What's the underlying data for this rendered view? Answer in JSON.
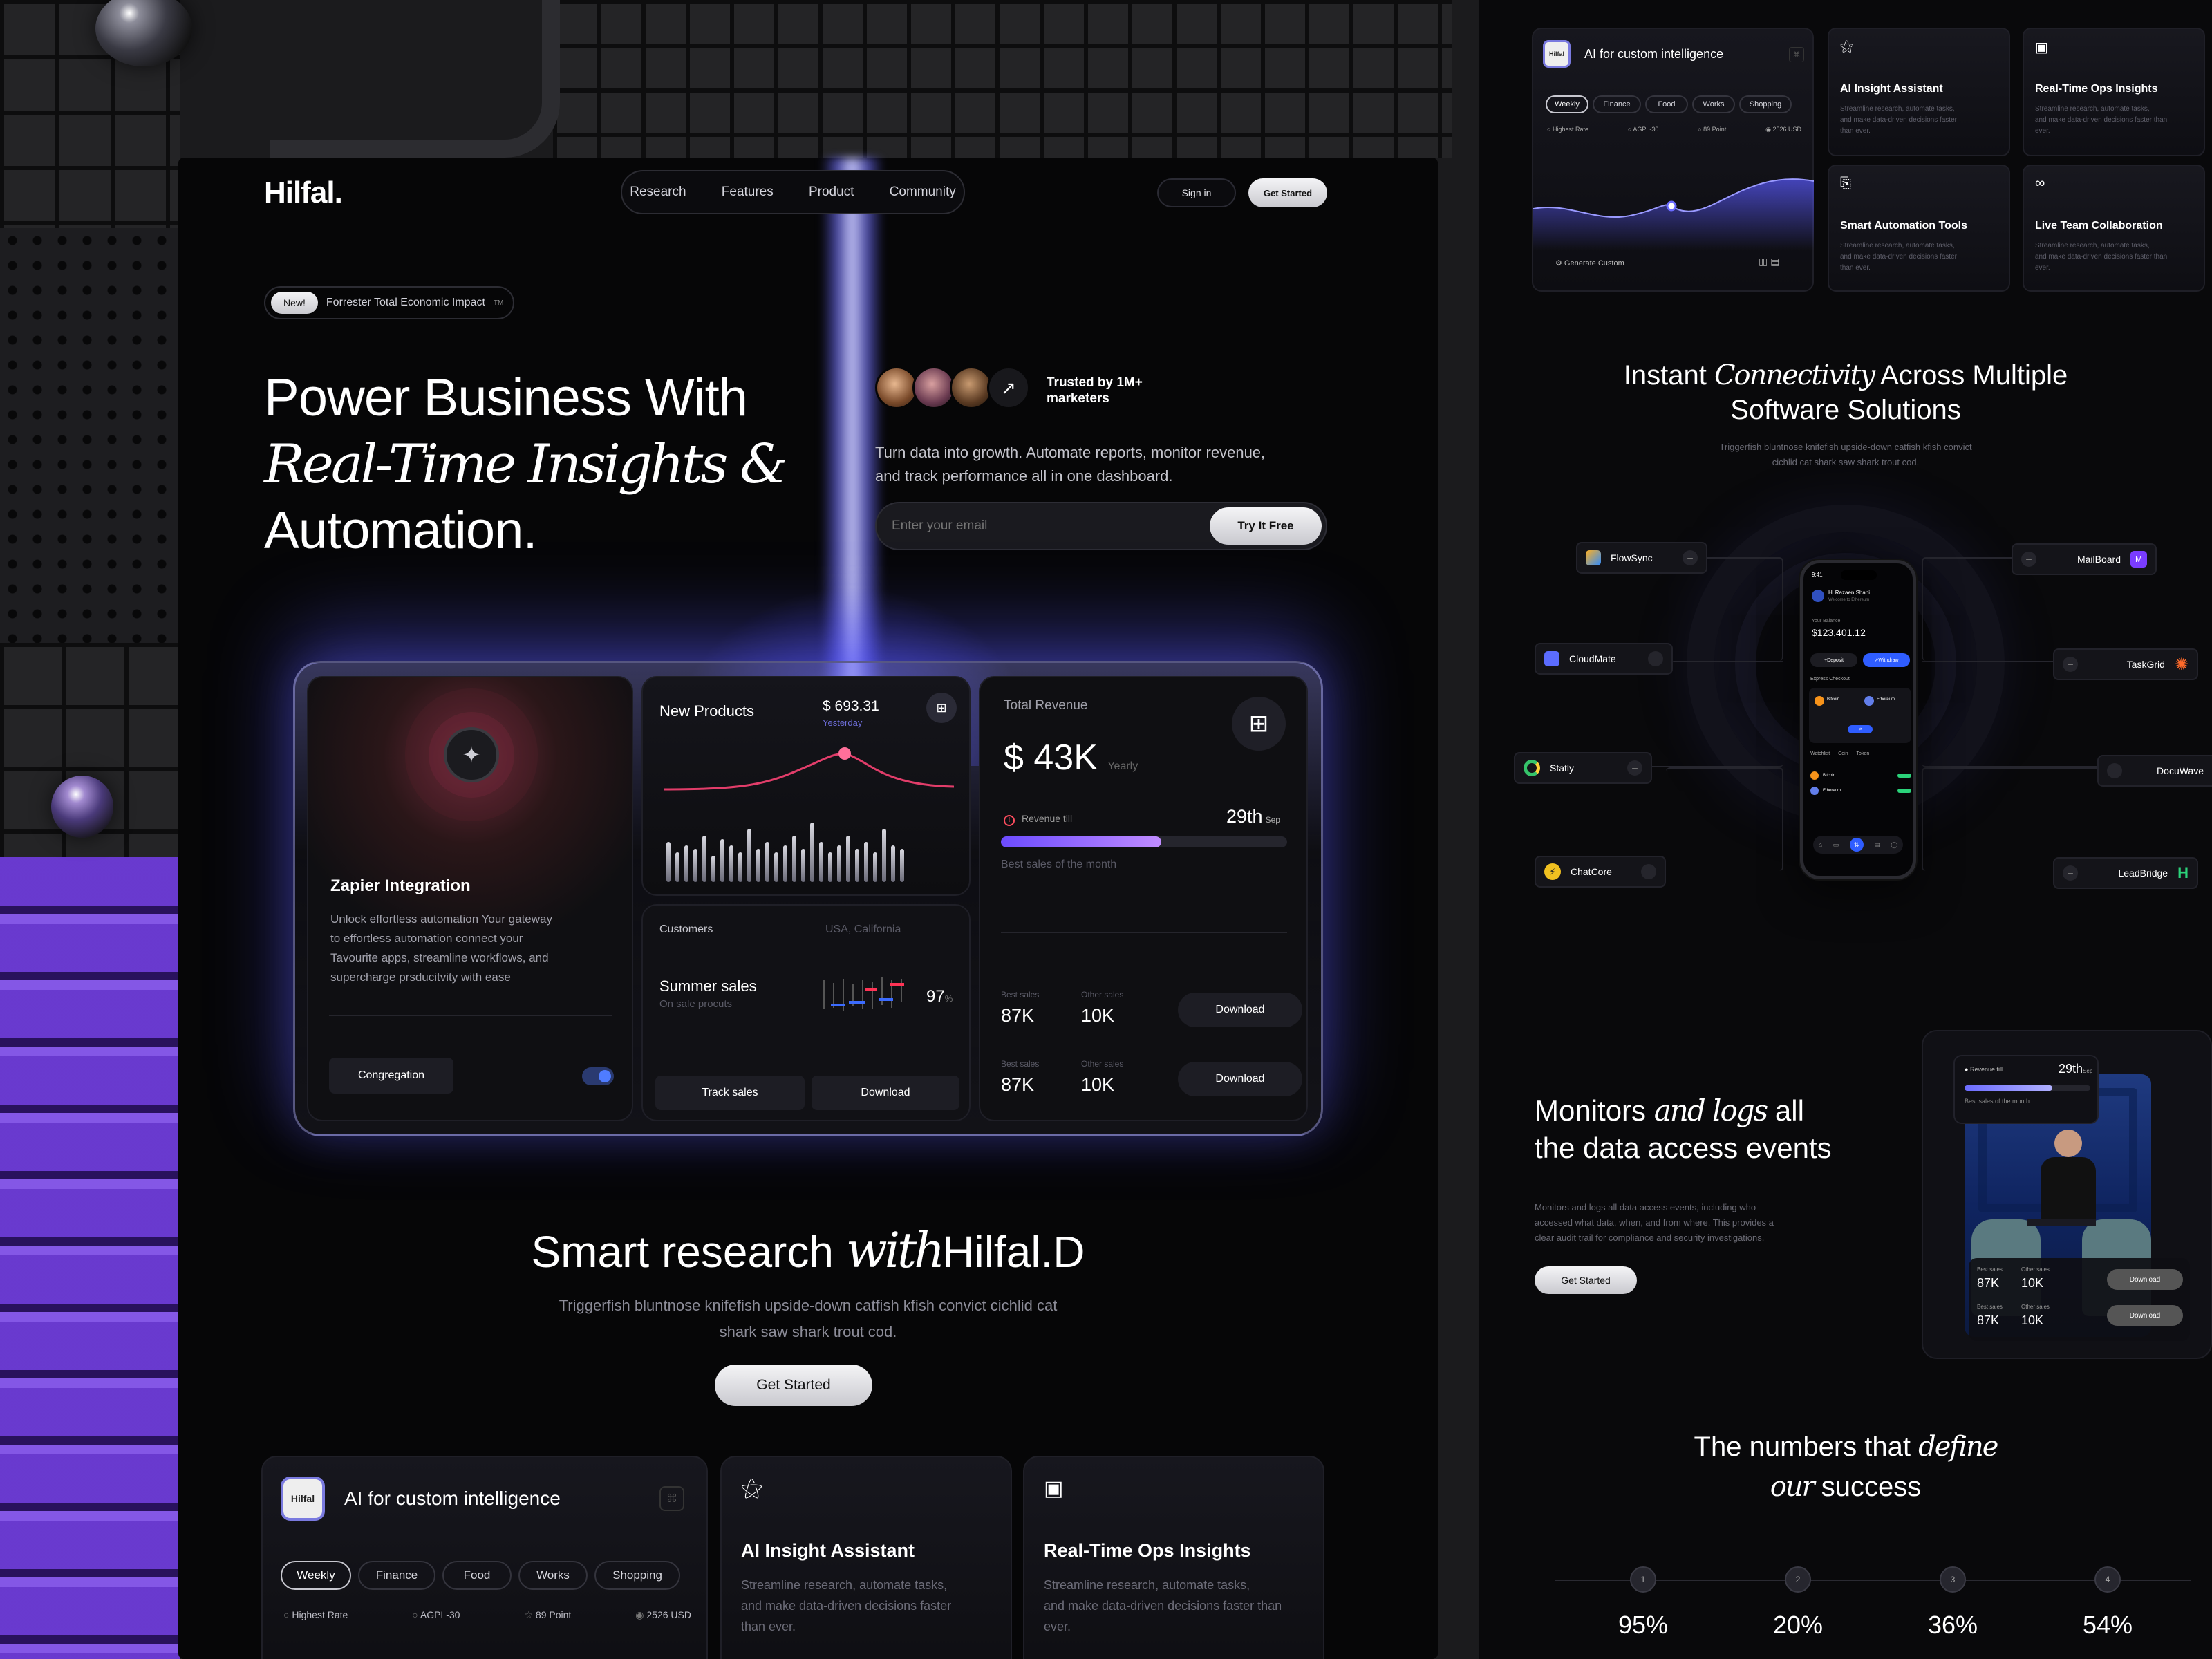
{
  "brand": "Hilfal.",
  "nav": {
    "items": [
      "Research",
      "Features",
      "Product",
      "Community"
    ],
    "signin": "Sign in",
    "get_started": "Get Started"
  },
  "badge": {
    "new": "New!",
    "text": "Forrester Total Economic Impact",
    "tm": "TM"
  },
  "hero": {
    "line1": "Power Business With",
    "line2": "Real-Time Insights &",
    "line3": "Automation.",
    "trusted": "Trusted by 1M+",
    "trusted2": "marketers",
    "desc1": "Turn data into growth. Automate reports, monitor revenue,",
    "desc2": "and track performance all in one dashboard.",
    "email_placeholder": "Enter your email",
    "try": "Try It Free"
  },
  "zapier": {
    "title": "Zapier Integration",
    "desc": [
      "Unlock effortless automation Your gateway",
      "to effortless automation connect your",
      "Tavourite apps, streamline workflows, and",
      "supercharge prsducitvity with ease"
    ],
    "button": "Congregation"
  },
  "products": {
    "title": "New Products",
    "price": "$ 693.31",
    "sub": "Yesterday",
    "bars": [
      0.6,
      0.45,
      0.55,
      0.5,
      0.7,
      0.4,
      0.65,
      0.55,
      0.45,
      0.8,
      0.5,
      0.6,
      0.45,
      0.55,
      0.7,
      0.5,
      0.9,
      0.6,
      0.45,
      0.55,
      0.7,
      0.5,
      0.6,
      0.45,
      0.8,
      0.55,
      0.5
    ]
  },
  "customers": {
    "title": "Customers",
    "location": "USA, California",
    "sales": "Summer sales",
    "sales_sub": "On sale procuts",
    "percent": "97",
    "percent_unit": "%",
    "track": "Track sales",
    "download": "Download"
  },
  "revenue": {
    "title": "Total Revenue",
    "amount": "$ 43K",
    "period": "Yearly",
    "till": "Revenue till",
    "date": "29th",
    "date_sub": "Sep",
    "best": "Best sales of the month",
    "progress": 0.56,
    "rows": [
      {
        "best_l": "Best sales",
        "best_v": "87K",
        "other_l": "Other sales",
        "other_v": "10K",
        "btn": "Download"
      },
      {
        "best_l": "Best sales",
        "best_v": "87K",
        "other_l": "Other sales",
        "other_v": "10K",
        "btn": "Download"
      }
    ]
  },
  "smart": {
    "t1": "Smart research",
    "t2": "with",
    "t3": "Hilfal.D",
    "d1": "Triggerfish bluntnose knifefish upside-down catfish kfish convict cichlid cat",
    "d2": "shark saw shark trout cod.",
    "btn": "Get Started"
  },
  "ai_card": {
    "logo": "Hilfal",
    "title": "AI for custom intelligence",
    "tags": [
      "Weekly",
      "Finance",
      "Food",
      "Works",
      "Shopping"
    ],
    "stats": [
      "Highest Rate",
      "AGPL-30",
      "89 Point",
      "2526 USD"
    ],
    "generate": "Generate Custom"
  },
  "features": [
    {
      "title": "AI Insight Assistant",
      "desc": [
        "Streamline research, automate tasks,",
        "and make data-driven decisions faster",
        "than ever."
      ]
    },
    {
      "title": "Real-Time Ops Insights",
      "desc": [
        "Streamline research, automate tasks,",
        "and make data-driven decisions faster than",
        "ever."
      ]
    },
    {
      "title": "Smart Automation Tools",
      "desc": [
        "Streamline research, automate tasks,",
        "and make data-driven decisions faster",
        "than ever."
      ]
    },
    {
      "title": "Live Team Collaboration",
      "desc": [
        "Streamline research, automate tasks,",
        "and make data-driven decisions faster than",
        "ever."
      ]
    }
  ],
  "connect": {
    "t1": "Instant",
    "t2": "Connectivity",
    "t3": "Across Multiple",
    "t4": "Software Solutions",
    "d1": "Triggerfish bluntnose knifefish upside-down catfish kfish convict",
    "d2": "cichlid cat shark saw shark trout cod.",
    "left": [
      "FlowSync",
      "CloudMate",
      "Statly",
      "ChatCore"
    ],
    "right": [
      "MailBoard",
      "TaskGrid",
      "DocuWave",
      "LeadBridge"
    ]
  },
  "phone": {
    "time": "9:41",
    "greet": "Hi Razaen Shahi",
    "greet_sub": "Welcome to Ethereum",
    "bal_label": "Your Balance",
    "balance": "$123,401.12",
    "deposit": "Deposit",
    "withdraw": "Withdraw",
    "express": "Express Checkout",
    "coin1": "Bitcoin",
    "coin2": "Ethereum",
    "tabs": [
      "Watchlist",
      "Coin",
      "Token"
    ]
  },
  "monitor": {
    "t1": "Monitors",
    "t2": "and logs",
    "t3": "all",
    "t4": "the data access events",
    "desc": [
      "Monitors and logs all data access events, including who",
      "accessed what data, when, and from where. This provides a",
      "clear audit trail for compliance and security investigations."
    ],
    "btn": "Get Started",
    "card": {
      "till": "Revenue till",
      "date": "29th",
      "date_sub": "Sep",
      "best": "Best sales of the month",
      "rows": [
        {
          "bl": "Best sales",
          "bv": "87K",
          "ol": "Other sales",
          "ov": "10K",
          "btn": "Download"
        },
        {
          "bl": "Best sales",
          "bv": "87K",
          "ol": "Other sales",
          "ov": "10K",
          "btn": "Download"
        }
      ]
    }
  },
  "numbers": {
    "t1": "The numbers that",
    "t2": "define",
    "t3": "our",
    "t4": "success",
    "steps": [
      "1",
      "2",
      "3",
      "4"
    ],
    "values": [
      "95%",
      "20%",
      "36%",
      "54%"
    ]
  }
}
